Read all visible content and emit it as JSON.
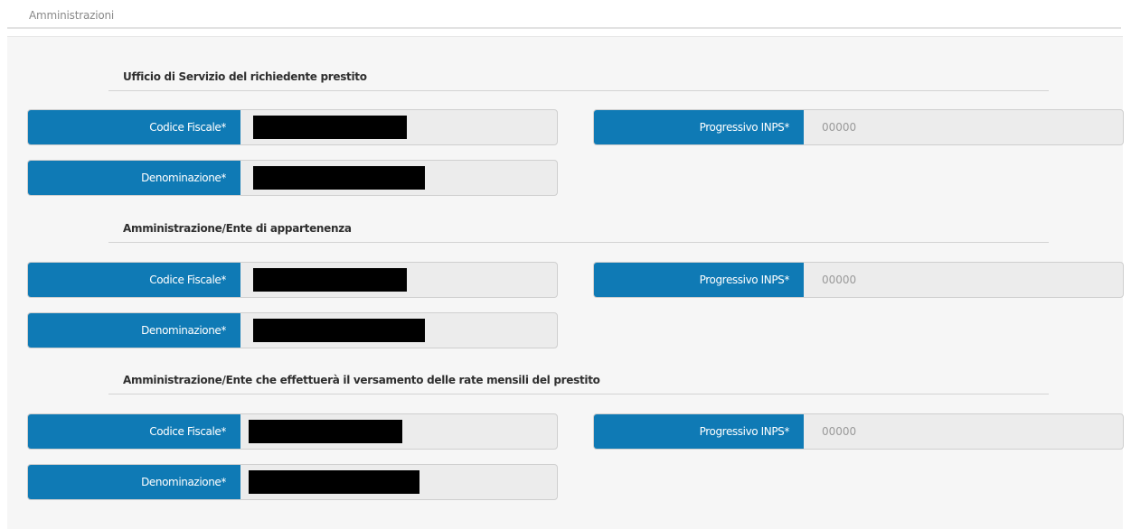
{
  "page": {
    "title": "Amministrazioni"
  },
  "sections": [
    {
      "title": "Ufficio di Servizio del richiedente prestito",
      "codice_fiscale": {
        "label": "Codice Fiscale*",
        "value": ""
      },
      "progressivo_inps": {
        "label": "Progressivo INPS*",
        "value": "00000"
      },
      "denominazione": {
        "label": "Denominazione*",
        "value": ""
      }
    },
    {
      "title": "Amministrazione/Ente di appartenenza",
      "codice_fiscale": {
        "label": "Codice Fiscale*",
        "value": ""
      },
      "progressivo_inps": {
        "label": "Progressivo INPS*",
        "value": "00000"
      },
      "denominazione": {
        "label": "Denominazione*",
        "value": ""
      }
    },
    {
      "title": "Amministrazione/Ente che effettuerà il versamento delle rate mensili del prestito",
      "codice_fiscale": {
        "label": "Codice Fiscale*",
        "value": ""
      },
      "progressivo_inps": {
        "label": "Progressivo INPS*",
        "value": "00000"
      },
      "denominazione": {
        "label": "Denominazione*",
        "value": ""
      }
    }
  ],
  "colors": {
    "label_bg": "#0f7ab5",
    "field_bg": "#ececec",
    "redaction": "#000000"
  }
}
